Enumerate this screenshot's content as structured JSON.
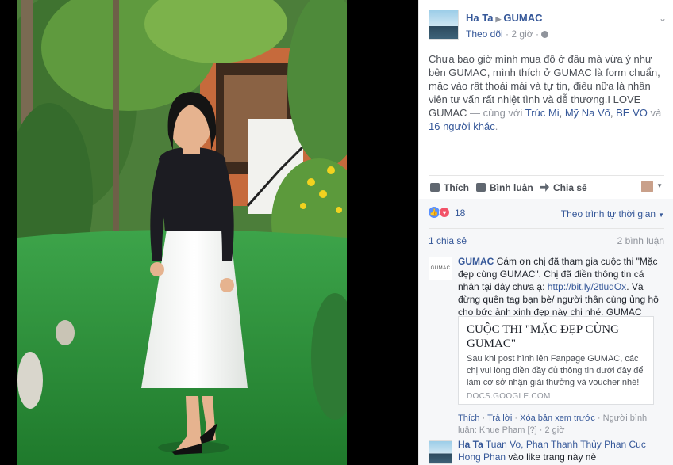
{
  "post": {
    "author": "Ha Ta",
    "page": "GUMAC",
    "follow": "Theo dõi",
    "time": "2 giờ",
    "text_main": "Chưa bao giờ mình mua đồ ở đâu mà vừa ý như bên GUMAC, mình thích ở GUMAC là form chuẩn, mặc vào rất thoải mái và tự tin, điều nữa là nhân viên tư vấn rất nhiệt tình và dễ thương.I LOVE GUMAC",
    "with_prefix": "— cùng với",
    "tag1": "Trúc Mi",
    "tag2": "Mỹ Na Võ",
    "tag3": "BE VO",
    "and_word": "và",
    "others": "16 người khác",
    "end_dot": "."
  },
  "actions": {
    "like": "Thích",
    "comment": "Bình luận",
    "share": "Chia sẻ"
  },
  "reactions": {
    "count": "18",
    "sort": "Theo trình tự thời gian"
  },
  "stats": {
    "shares": "1 chia sẻ",
    "comments": "2 bình luận"
  },
  "comment": {
    "avatar_text": "GUMAC",
    "name": "GUMAC",
    "text1": "Cám ơn chị đã tham gia cuộc thi \"Mặc đẹp cùng GUMAC\". Chị đã điền thông tin cá nhân tại đây chưa ạ:",
    "url": "http://bit.ly/2tludOx",
    "text2": ". Và đừng quên tag bạn bè/ người thân cùng ủng hộ cho bức ảnh xinh đẹp này chị nhé. GUMAC LOVE YOU",
    "card_title": "CUỘC THI \"MẶC ĐẸP CÙNG GUMAC\"",
    "card_desc": "Sau khi post hình lên Fanpage GUMAC, các chị vui lòng điền đầy đủ thông tin dưới đây để làm cơ sở nhận giải thưởng và voucher nhé!",
    "card_domain": "DOCS.GOOGLE.COM",
    "like": "Thích",
    "reply": "Trả lời",
    "remove_preview": "Xóa bản xem trước",
    "commenter": "Người bình luận: Khue Pham",
    "sep": "·",
    "footnote": "[?]",
    "time": "2 giờ"
  },
  "reply": {
    "name": "Ha Ta",
    "tags": "Tuan Vo, Phan Thanh Thủy Phan Cuc Hong Phan",
    "text": "vào like trang này nè"
  },
  "colors": {
    "link": "#365899",
    "muted": "#90949c",
    "panel_bg": "#f6f7f9"
  }
}
